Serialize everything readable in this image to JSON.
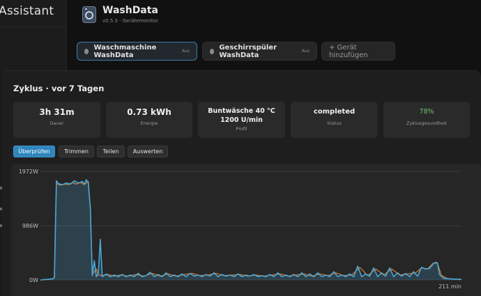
{
  "sidebar": {
    "title": "Assistant"
  },
  "header": {
    "title": "WashData",
    "subtitle": "v0.5.3 · Gerätemonitor"
  },
  "devices": [
    {
      "label": "Waschmaschine WashData",
      "state": "Aus",
      "active": true
    },
    {
      "label": "Geschirrspüler WashData",
      "state": "Aus",
      "active": false
    }
  ],
  "add_device_label": "+ Gerät hinzufügen",
  "cycle": {
    "title": "Zyklus · vor 7 Tagen",
    "stats": {
      "duration": {
        "value": "3h 31m",
        "label": "Dauer"
      },
      "energy": {
        "value": "0.73 kWh",
        "label": "Energie"
      },
      "profile": {
        "value": "Buntwäsche 40 °C 1200 U/min",
        "label": "Profil"
      },
      "status": {
        "value": "completed",
        "label": "Status"
      },
      "health": {
        "value": "78%",
        "label": "Zyklusgesundheit"
      }
    },
    "actions": {
      "review": "Überprüfen",
      "trim": "Trimmen",
      "share": "Teilen",
      "analyze": "Auswerten"
    }
  },
  "colors": {
    "accent": "#2f86bd",
    "series_power": "#4aa6d6",
    "series_overlay": "#d07a2a",
    "health": "#6cc06c"
  },
  "chart_data": {
    "type": "line",
    "title": "",
    "xlabel": "",
    "ylabel": "",
    "x_end_label": "211 min",
    "yticks": [
      {
        "value": 1972,
        "label": "1972W"
      },
      {
        "value": 986,
        "label": "986W"
      },
      {
        "value": 0,
        "label": "0W"
      }
    ],
    "ylim": [
      0,
      1972
    ],
    "xlim": [
      0,
      211
    ],
    "grid": true,
    "series": [
      {
        "values": [
          [
            0,
            0
          ],
          [
            3,
            10
          ],
          [
            6,
            20
          ],
          [
            7,
            40
          ],
          [
            8,
            1800
          ],
          [
            9,
            1750
          ],
          [
            11,
            1730
          ],
          [
            13,
            1760
          ],
          [
            15,
            1740
          ],
          [
            17,
            1800
          ],
          [
            19,
            1760
          ],
          [
            21,
            1790
          ],
          [
            22,
            1740
          ],
          [
            23,
            1820
          ],
          [
            24,
            1760
          ],
          [
            25,
            1300
          ],
          [
            26,
            80
          ],
          [
            27,
            350
          ],
          [
            28,
            60
          ],
          [
            29,
            120
          ],
          [
            30,
            740
          ],
          [
            31,
            60
          ],
          [
            33,
            110
          ],
          [
            35,
            60
          ],
          [
            37,
            90
          ],
          [
            39,
            60
          ],
          [
            41,
            100
          ],
          [
            43,
            60
          ],
          [
            45,
            90
          ],
          [
            47,
            60
          ],
          [
            49,
            120
          ],
          [
            51,
            60
          ],
          [
            53,
            80
          ],
          [
            55,
            140
          ],
          [
            57,
            60
          ],
          [
            59,
            100
          ],
          [
            61,
            60
          ],
          [
            63,
            130
          ],
          [
            65,
            60
          ],
          [
            67,
            90
          ],
          [
            69,
            60
          ],
          [
            71,
            110
          ],
          [
            73,
            60
          ],
          [
            75,
            120
          ],
          [
            77,
            70
          ],
          [
            79,
            90
          ],
          [
            81,
            60
          ],
          [
            83,
            100
          ],
          [
            85,
            70
          ],
          [
            87,
            130
          ],
          [
            89,
            60
          ],
          [
            91,
            100
          ],
          [
            93,
            70
          ],
          [
            95,
            90
          ],
          [
            97,
            60
          ],
          [
            99,
            110
          ],
          [
            101,
            60
          ],
          [
            103,
            90
          ],
          [
            105,
            70
          ],
          [
            107,
            100
          ],
          [
            109,
            60
          ],
          [
            111,
            80
          ],
          [
            113,
            60
          ],
          [
            115,
            100
          ],
          [
            117,
            60
          ],
          [
            119,
            130
          ],
          [
            121,
            60
          ],
          [
            123,
            90
          ],
          [
            125,
            60
          ],
          [
            127,
            100
          ],
          [
            129,
            60
          ],
          [
            131,
            130
          ],
          [
            133,
            60
          ],
          [
            135,
            110
          ],
          [
            137,
            60
          ],
          [
            139,
            130
          ],
          [
            141,
            60
          ],
          [
            143,
            90
          ],
          [
            145,
            60
          ],
          [
            147,
            150
          ],
          [
            149,
            60
          ],
          [
            151,
            90
          ],
          [
            153,
            60
          ],
          [
            155,
            110
          ],
          [
            157,
            60
          ],
          [
            159,
            250
          ],
          [
            161,
            60
          ],
          [
            163,
            110
          ],
          [
            165,
            70
          ],
          [
            167,
            220
          ],
          [
            169,
            60
          ],
          [
            171,
            130
          ],
          [
            173,
            70
          ],
          [
            175,
            220
          ],
          [
            177,
            60
          ],
          [
            179,
            130
          ],
          [
            181,
            70
          ],
          [
            183,
            120
          ],
          [
            185,
            60
          ],
          [
            187,
            150
          ],
          [
            189,
            70
          ],
          [
            191,
            230
          ],
          [
            193,
            200
          ],
          [
            195,
            210
          ],
          [
            197,
            300
          ],
          [
            198,
            320
          ],
          [
            199,
            310
          ],
          [
            200,
            100
          ],
          [
            202,
            30
          ],
          [
            205,
            20
          ],
          [
            208,
            15
          ],
          [
            211,
            10
          ]
        ]
      },
      {
        "values": [
          [
            0,
            0
          ],
          [
            3,
            10
          ],
          [
            6,
            20
          ],
          [
            7,
            40
          ],
          [
            8,
            1750
          ],
          [
            10,
            1720
          ],
          [
            12,
            1740
          ],
          [
            14,
            1730
          ],
          [
            16,
            1770
          ],
          [
            18,
            1740
          ],
          [
            20,
            1770
          ],
          [
            22,
            1730
          ],
          [
            24,
            1790
          ],
          [
            25,
            1300
          ],
          [
            26,
            100
          ],
          [
            28,
            200
          ],
          [
            29,
            90
          ],
          [
            31,
            80
          ],
          [
            34,
            100
          ],
          [
            37,
            70
          ],
          [
            40,
            90
          ],
          [
            44,
            70
          ],
          [
            48,
            100
          ],
          [
            52,
            70
          ],
          [
            56,
            120
          ],
          [
            60,
            70
          ],
          [
            64,
            110
          ],
          [
            68,
            70
          ],
          [
            72,
            100
          ],
          [
            76,
            120
          ],
          [
            80,
            80
          ],
          [
            84,
            90
          ],
          [
            88,
            120
          ],
          [
            92,
            80
          ],
          [
            96,
            90
          ],
          [
            100,
            100
          ],
          [
            104,
            70
          ],
          [
            108,
            90
          ],
          [
            112,
            70
          ],
          [
            116,
            90
          ],
          [
            120,
            110
          ],
          [
            124,
            70
          ],
          [
            128,
            90
          ],
          [
            132,
            110
          ],
          [
            136,
            70
          ],
          [
            140,
            110
          ],
          [
            144,
            80
          ],
          [
            148,
            130
          ],
          [
            152,
            80
          ],
          [
            156,
            90
          ],
          [
            160,
            230
          ],
          [
            164,
            80
          ],
          [
            168,
            200
          ],
          [
            172,
            90
          ],
          [
            176,
            200
          ],
          [
            180,
            90
          ],
          [
            184,
            110
          ],
          [
            188,
            130
          ],
          [
            191,
            220
          ],
          [
            194,
            200
          ],
          [
            197,
            310
          ],
          [
            199,
            300
          ],
          [
            201,
            80
          ],
          [
            204,
            25
          ],
          [
            208,
            15
          ],
          [
            211,
            10
          ]
        ]
      }
    ]
  }
}
